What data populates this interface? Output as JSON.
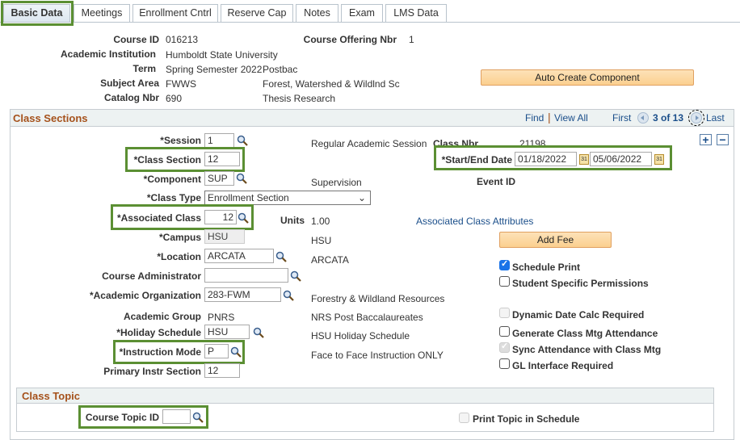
{
  "tabs": [
    {
      "label": "Basic Data",
      "active": true
    },
    {
      "label": "Meetings"
    },
    {
      "label": "Enrollment Cntrl"
    },
    {
      "label": "Reserve Cap"
    },
    {
      "label": "Notes"
    },
    {
      "label": "Exam"
    },
    {
      "label": "LMS Data"
    }
  ],
  "header": {
    "course_id_label": "Course ID",
    "course_id": "016213",
    "offering_label": "Course Offering Nbr",
    "offering": "1",
    "institution_label": "Academic Institution",
    "institution": "Humboldt State University",
    "term_label": "Term",
    "term": "Spring Semester 2022",
    "term_desc": "Postbac",
    "subject_label": "Subject Area",
    "subject": "FWWS",
    "subject_desc": "Forest, Watershed & Wildlnd Sc",
    "catalog_label": "Catalog Nbr",
    "catalog": "690",
    "catalog_desc": "Thesis Research",
    "auto_create_label": "Auto Create Component"
  },
  "class_sections": {
    "title": "Class Sections",
    "nav": {
      "find": "Find",
      "view_all": "View All",
      "first": "First",
      "position": "3 of 13",
      "last": "Last"
    },
    "session_label": "*Session",
    "session": "1",
    "session_desc": "Regular Academic Session",
    "class_nbr_label": "Class Nbr",
    "class_nbr": "21198",
    "class_section_label": "*Class Section",
    "class_section": "12",
    "start_end_label": "*Start/End Date",
    "start_date": "01/18/2022",
    "end_date": "05/06/2022",
    "component_label": "*Component",
    "component": "SUP",
    "component_desc": "Supervision",
    "event_id_label": "Event ID",
    "class_type_label": "*Class Type",
    "class_type": "Enrollment Section",
    "assoc_class_label": "*Associated Class",
    "assoc_class": "12",
    "units_label": "Units",
    "units": "1.00",
    "assoc_attr_link": "Associated Class Attributes",
    "campus_label": "*Campus",
    "campus": "HSU",
    "campus_desc": "HSU",
    "add_fee_label": "Add Fee",
    "location_label": "*Location",
    "location": "ARCATA",
    "location_desc": "ARCATA",
    "course_admin_label": "Course Administrator",
    "course_admin": "",
    "acad_org_label": "*Academic Organization",
    "acad_org": "283-FWM",
    "acad_org_desc": "Forestry & Wildland Resources",
    "acad_group_label": "Academic Group",
    "acad_group": "PNRS",
    "acad_group_desc": "NRS Post Baccalaureates",
    "holiday_label": "*Holiday Schedule",
    "holiday": "HSU",
    "holiday_desc": "HSU Holiday Schedule",
    "instr_mode_label": "*Instruction Mode",
    "instr_mode": "P",
    "instr_mode_desc": "Face to Face Instruction ONLY",
    "primary_label": "Primary Instr Section",
    "primary": "12",
    "checkboxes": [
      {
        "label": "Schedule Print",
        "checked": true,
        "disabled": false
      },
      {
        "label": "Student Specific Permissions",
        "checked": false,
        "disabled": false
      },
      {
        "label": "Dynamic Date Calc Required",
        "checked": false,
        "disabled": true
      },
      {
        "label": "Generate Class Mtg Attendance",
        "checked": false,
        "disabled": false
      },
      {
        "label": "Sync Attendance with Class Mtg",
        "checked": true,
        "disabled": true
      },
      {
        "label": "GL Interface Required",
        "checked": false,
        "disabled": false
      }
    ]
  },
  "class_topic": {
    "title": "Class Topic",
    "topic_id_label": "Course Topic ID",
    "topic_id": "",
    "print_topic_label": "Print Topic in Schedule",
    "print_topic_checked": false
  },
  "colors": {
    "highlight": "#5b8f33",
    "section_title": "#a5511b",
    "link": "#1a4e8a",
    "button": "#fbd08f"
  }
}
